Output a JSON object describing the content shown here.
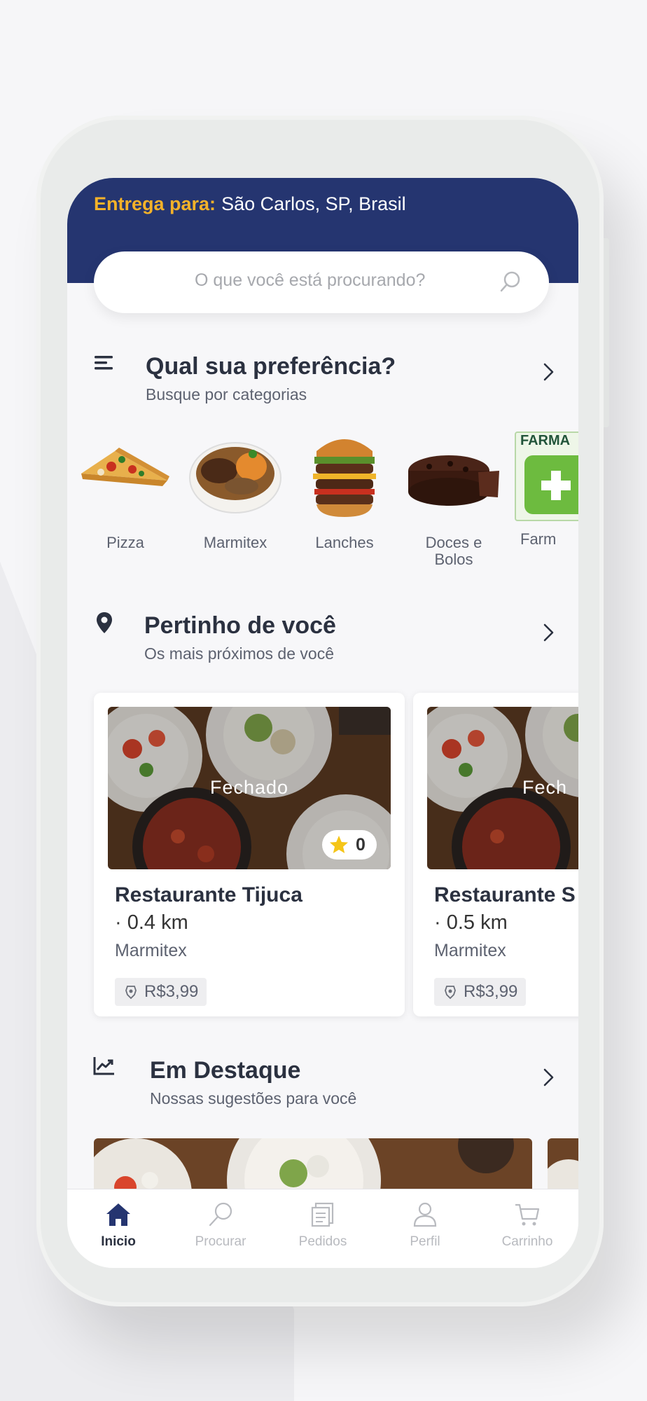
{
  "header": {
    "delivery_label": "Entrega para:",
    "delivery_location": "São Carlos, SP, Brasil",
    "background_color": "#253570",
    "label_color": "#f4b229"
  },
  "search": {
    "placeholder": "O que você está procurando?",
    "icon": "search-icon"
  },
  "sections": {
    "categories": {
      "title": "Qual sua preferência?",
      "subtitle": "Busque por categorias",
      "icon": "list-icon"
    },
    "nearby": {
      "title": "Pertinho de você",
      "subtitle": "Os mais próximos de você",
      "icon": "location-pin-icon"
    },
    "featured": {
      "title": "Em Destaque",
      "subtitle": "Nossas sugestões para você",
      "icon": "trending-chart-icon"
    }
  },
  "categories": [
    {
      "label": "Pizza",
      "icon": "pizza-image"
    },
    {
      "label": "Marmitex",
      "icon": "marmitex-image"
    },
    {
      "label": "Lanches",
      "icon": "burger-image"
    },
    {
      "label": "Doces e\nBolos",
      "line1": "Doces e",
      "line2": "Bolos",
      "icon": "cake-image"
    },
    {
      "label": "Farm",
      "icon": "pharmacy-image",
      "badge_text": "FARMA"
    }
  ],
  "restaurants": [
    {
      "name": "Restaurante Tijuca",
      "distance": "· 0.4 km",
      "category": "Marmitex",
      "status": "Fechado",
      "rating": "0",
      "delivery_fee": "R$3,99"
    },
    {
      "name": "Restaurante S",
      "distance": "· 0.5 km",
      "category": "Marmitex",
      "status": "Fech",
      "delivery_fee": "R$3,99"
    }
  ],
  "nav": [
    {
      "label": "Inicio",
      "icon": "home-icon",
      "active": true
    },
    {
      "label": "Procurar",
      "icon": "search-icon",
      "active": false
    },
    {
      "label": "Pedidos",
      "icon": "orders-icon",
      "active": false
    },
    {
      "label": "Perfil",
      "icon": "user-icon",
      "active": false
    },
    {
      "label": "Carrinho",
      "icon": "cart-icon",
      "active": false
    }
  ]
}
